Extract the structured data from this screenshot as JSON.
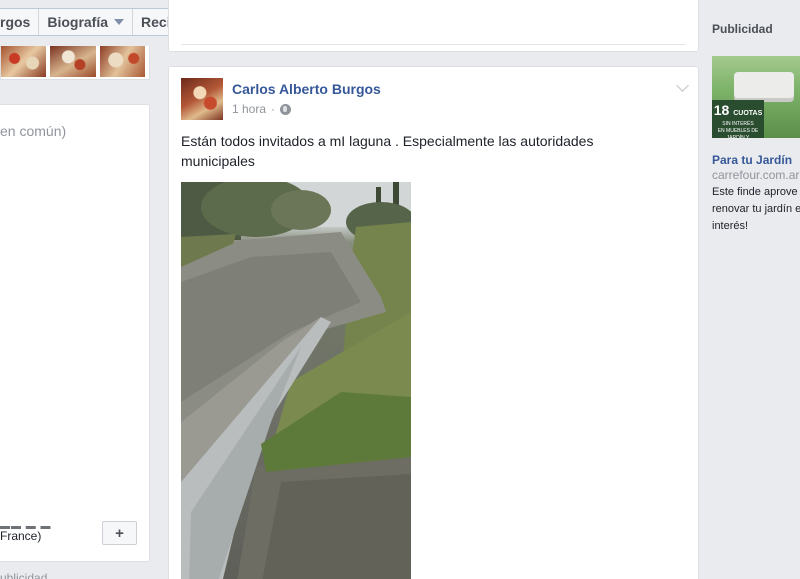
{
  "tabs": [
    {
      "label": "rgos",
      "dropdown": false
    },
    {
      "label": "Biografía",
      "dropdown": true
    },
    {
      "label": "Reciente",
      "dropdown": true
    }
  ],
  "left": {
    "common_text": "en común)",
    "item_text": "France)",
    "add_label": "+",
    "bottom_text": "ublicidad"
  },
  "post": {
    "author": "Carlos Alberto Burgos",
    "time": "1 hora",
    "privacy_icon": "globe-icon",
    "text": "Están todos invitados a mI laguna . Especialmente las autoridades municipales"
  },
  "sidebar": {
    "heading": "Publicidad",
    "ad": {
      "badge_number": "18",
      "badge_unit": "CUOTAS",
      "badge_line1": "SIN INTERÉS",
      "badge_line2": "EN MUEBLES DE JARDÍN Y COLCHONES",
      "title": "Para tu Jardín",
      "domain": "carrefour.com.ar",
      "body": "Este finde aprove renovar tu jardín e sin interés!"
    }
  },
  "colors": {
    "link": "#365899",
    "muted": "#90949c",
    "background": "#e9ebee"
  }
}
